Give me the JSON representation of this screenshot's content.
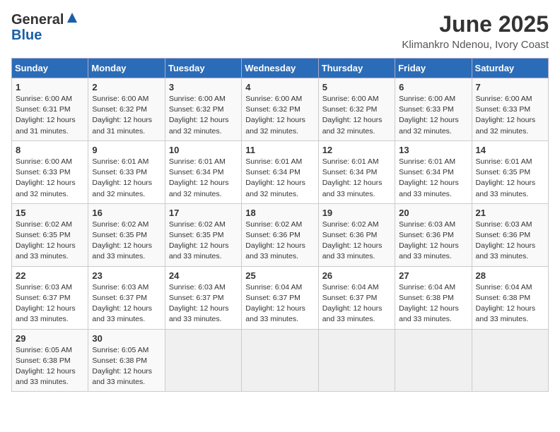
{
  "header": {
    "logo_general": "General",
    "logo_blue": "Blue",
    "title": "June 2025",
    "subtitle": "Klimankro Ndenou, Ivory Coast"
  },
  "weekdays": [
    "Sunday",
    "Monday",
    "Tuesday",
    "Wednesday",
    "Thursday",
    "Friday",
    "Saturday"
  ],
  "weeks": [
    [
      {
        "day": "1",
        "sunrise": "6:00 AM",
        "sunset": "6:31 PM",
        "daylight": "12 hours and 31 minutes."
      },
      {
        "day": "2",
        "sunrise": "6:00 AM",
        "sunset": "6:32 PM",
        "daylight": "12 hours and 31 minutes."
      },
      {
        "day": "3",
        "sunrise": "6:00 AM",
        "sunset": "6:32 PM",
        "daylight": "12 hours and 32 minutes."
      },
      {
        "day": "4",
        "sunrise": "6:00 AM",
        "sunset": "6:32 PM",
        "daylight": "12 hours and 32 minutes."
      },
      {
        "day": "5",
        "sunrise": "6:00 AM",
        "sunset": "6:32 PM",
        "daylight": "12 hours and 32 minutes."
      },
      {
        "day": "6",
        "sunrise": "6:00 AM",
        "sunset": "6:33 PM",
        "daylight": "12 hours and 32 minutes."
      },
      {
        "day": "7",
        "sunrise": "6:00 AM",
        "sunset": "6:33 PM",
        "daylight": "12 hours and 32 minutes."
      }
    ],
    [
      {
        "day": "8",
        "sunrise": "6:00 AM",
        "sunset": "6:33 PM",
        "daylight": "12 hours and 32 minutes."
      },
      {
        "day": "9",
        "sunrise": "6:01 AM",
        "sunset": "6:33 PM",
        "daylight": "12 hours and 32 minutes."
      },
      {
        "day": "10",
        "sunrise": "6:01 AM",
        "sunset": "6:34 PM",
        "daylight": "12 hours and 32 minutes."
      },
      {
        "day": "11",
        "sunrise": "6:01 AM",
        "sunset": "6:34 PM",
        "daylight": "12 hours and 32 minutes."
      },
      {
        "day": "12",
        "sunrise": "6:01 AM",
        "sunset": "6:34 PM",
        "daylight": "12 hours and 33 minutes."
      },
      {
        "day": "13",
        "sunrise": "6:01 AM",
        "sunset": "6:34 PM",
        "daylight": "12 hours and 33 minutes."
      },
      {
        "day": "14",
        "sunrise": "6:01 AM",
        "sunset": "6:35 PM",
        "daylight": "12 hours and 33 minutes."
      }
    ],
    [
      {
        "day": "15",
        "sunrise": "6:02 AM",
        "sunset": "6:35 PM",
        "daylight": "12 hours and 33 minutes."
      },
      {
        "day": "16",
        "sunrise": "6:02 AM",
        "sunset": "6:35 PM",
        "daylight": "12 hours and 33 minutes."
      },
      {
        "day": "17",
        "sunrise": "6:02 AM",
        "sunset": "6:35 PM",
        "daylight": "12 hours and 33 minutes."
      },
      {
        "day": "18",
        "sunrise": "6:02 AM",
        "sunset": "6:36 PM",
        "daylight": "12 hours and 33 minutes."
      },
      {
        "day": "19",
        "sunrise": "6:02 AM",
        "sunset": "6:36 PM",
        "daylight": "12 hours and 33 minutes."
      },
      {
        "day": "20",
        "sunrise": "6:03 AM",
        "sunset": "6:36 PM",
        "daylight": "12 hours and 33 minutes."
      },
      {
        "day": "21",
        "sunrise": "6:03 AM",
        "sunset": "6:36 PM",
        "daylight": "12 hours and 33 minutes."
      }
    ],
    [
      {
        "day": "22",
        "sunrise": "6:03 AM",
        "sunset": "6:37 PM",
        "daylight": "12 hours and 33 minutes."
      },
      {
        "day": "23",
        "sunrise": "6:03 AM",
        "sunset": "6:37 PM",
        "daylight": "12 hours and 33 minutes."
      },
      {
        "day": "24",
        "sunrise": "6:03 AM",
        "sunset": "6:37 PM",
        "daylight": "12 hours and 33 minutes."
      },
      {
        "day": "25",
        "sunrise": "6:04 AM",
        "sunset": "6:37 PM",
        "daylight": "12 hours and 33 minutes."
      },
      {
        "day": "26",
        "sunrise": "6:04 AM",
        "sunset": "6:37 PM",
        "daylight": "12 hours and 33 minutes."
      },
      {
        "day": "27",
        "sunrise": "6:04 AM",
        "sunset": "6:38 PM",
        "daylight": "12 hours and 33 minutes."
      },
      {
        "day": "28",
        "sunrise": "6:04 AM",
        "sunset": "6:38 PM",
        "daylight": "12 hours and 33 minutes."
      }
    ],
    [
      {
        "day": "29",
        "sunrise": "6:05 AM",
        "sunset": "6:38 PM",
        "daylight": "12 hours and 33 minutes."
      },
      {
        "day": "30",
        "sunrise": "6:05 AM",
        "sunset": "6:38 PM",
        "daylight": "12 hours and 33 minutes."
      },
      null,
      null,
      null,
      null,
      null
    ]
  ]
}
